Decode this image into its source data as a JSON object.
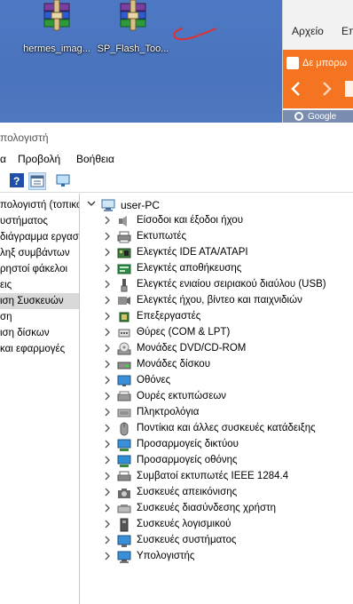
{
  "desktop": {
    "icons": [
      {
        "label": "hermes_imag...",
        "icon": "winrar-archive-icon"
      },
      {
        "label": "SP_Flash_Too...",
        "icon": "winrar-archive-icon"
      }
    ]
  },
  "browser": {
    "menu": [
      "Αρχείο",
      "Επ"
    ],
    "banner_text": "Δε μπορω",
    "tab_text": "Google"
  },
  "window": {
    "title": "πολογιστή",
    "menu": [
      "α",
      "Προβολή",
      "Βοήθεια"
    ]
  },
  "left_pane": {
    "items": [
      "πολογιστή (τοπικό",
      "υστήματος",
      "διάγραμμα εργασ",
      "ληξ συμβάντων",
      "ρηστοί φάκελοι",
      "εις",
      "ιση Συσκευών",
      "ση",
      "ιση δίσκων",
      "και εφαρμογές"
    ],
    "selected_index": 6
  },
  "device_tree": {
    "root": "user-PC",
    "categories": [
      {
        "label": "Είσοδοι και έξοδοι ήχου",
        "icon": "speaker-icon"
      },
      {
        "label": "Εκτυπωτές",
        "icon": "printer-icon"
      },
      {
        "label": "Ελεγκτές IDE ATA/ATAPI",
        "icon": "ide-controller-icon"
      },
      {
        "label": "Ελεγκτές αποθήκευσης",
        "icon": "storage-controller-icon"
      },
      {
        "label": "Ελεγκτές ενιαίου σειριακού διαύλου (USB)",
        "icon": "usb-icon"
      },
      {
        "label": "Ελεγκτές ήχου, βίντεο και παιχνιδιών",
        "icon": "sound-video-icon"
      },
      {
        "label": "Επεξεργαστές",
        "icon": "processor-icon"
      },
      {
        "label": "Θύρες (COM & LPT)",
        "icon": "port-icon"
      },
      {
        "label": "Μονάδες DVD/CD-ROM",
        "icon": "dvd-drive-icon"
      },
      {
        "label": "Μονάδες δίσκου",
        "icon": "disk-drive-icon"
      },
      {
        "label": "Οθόνες",
        "icon": "monitor-icon"
      },
      {
        "label": "Ουρές εκτυπώσεων",
        "icon": "print-queue-icon"
      },
      {
        "label": "Πληκτρολόγια",
        "icon": "keyboard-icon"
      },
      {
        "label": "Ποντίκια και άλλες συσκευές κατάδειξης",
        "icon": "mouse-icon"
      },
      {
        "label": "Προσαρμογείς δικτύου",
        "icon": "network-adapter-icon"
      },
      {
        "label": "Προσαρμογείς οθόνης",
        "icon": "display-adapter-icon"
      },
      {
        "label": "Συμβατοί εκτυπωτές IEEE 1284.4",
        "icon": "ieee-printer-icon"
      },
      {
        "label": "Συσκευές απεικόνισης",
        "icon": "imaging-device-icon"
      },
      {
        "label": "Συσκευές διασύνδεσης χρήστη",
        "icon": "hid-icon"
      },
      {
        "label": "Συσκευές λογισμικού",
        "icon": "software-device-icon"
      },
      {
        "label": "Συσκευές συστήματος",
        "icon": "system-device-icon"
      },
      {
        "label": "Υπολογιστής",
        "icon": "computer-icon"
      }
    ]
  }
}
